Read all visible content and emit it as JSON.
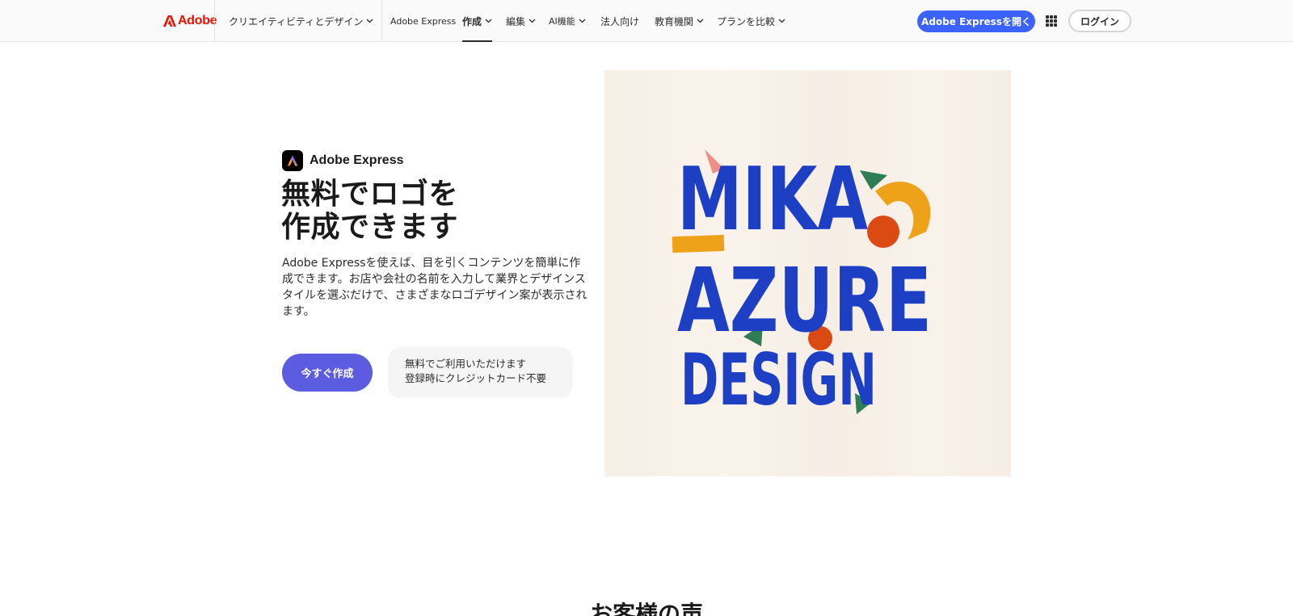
{
  "nav": {
    "brand": "Adobe",
    "items": [
      {
        "label": "クリエイティビティとデザイン",
        "has_menu": true
      },
      {
        "label": "Adobe Express",
        "has_menu": false
      },
      {
        "label": "作成",
        "has_menu": true,
        "active": true
      },
      {
        "label": "編集",
        "has_menu": true
      },
      {
        "label": "AI機能",
        "has_menu": true
      },
      {
        "label": "法人向け",
        "has_menu": false
      },
      {
        "label": "教育機関",
        "has_menu": true
      },
      {
        "label": "プランを比較",
        "has_menu": true
      }
    ],
    "open_button": "Adobe Expressを開く",
    "apps_icon": "apps-grid-icon",
    "login_button": "ログイン"
  },
  "hero": {
    "product_name": "Adobe Express",
    "title_lines": [
      "無料でロゴを",
      "作成できます"
    ],
    "description": "Adobe Expressを使えば、目を引くコンテンツを簡単に作成できます。お店や会社の名前を入力して業界とデザインスタイルを選ぶだけで、さまざまなロゴデザイン案が表示されます。",
    "cta_button": "今すぐ作成",
    "note_lines": [
      "無料でご利用いただけます",
      "登録時にクレジットカード不要"
    ]
  },
  "logo_art": {
    "line1": "MIKA",
    "line2": "AZURE",
    "line3": "DESIGN",
    "colors": {
      "text": "#1d3fc4",
      "orange": "#dc4a14",
      "yellow": "#eea21a",
      "green": "#2e7d55",
      "pink": "#ef8d86",
      "background": "#f7f0e7"
    }
  },
  "section": {
    "title": "お客様の声"
  },
  "colors": {
    "brand_red": "#eb1000",
    "primary_blue": "#3b63fb",
    "cta_purple": "#5c5ce0"
  }
}
